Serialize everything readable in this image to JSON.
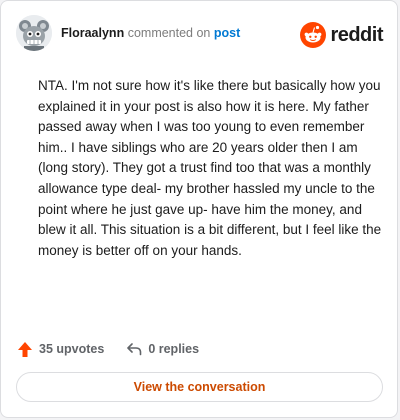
{
  "header": {
    "username": "Floraalynn",
    "action_text": "commented on",
    "post_link": "post",
    "brand": "reddit"
  },
  "comment": {
    "body": "NTA. I'm not sure how it's like there but basically how you explained it in your post is also how it is here. My father passed away when I was too young to even remember him.. I have siblings who are 20 years older then I am (long story). They got a trust find too that was a monthly allowance type deal- my brother hassled my uncle to the point where he just gave up- have him the money, and blew it all. This situation is a bit different, but I feel like the money is better off on your hands."
  },
  "actions": {
    "upvotes": "35 upvotes",
    "replies": "0 replies"
  },
  "footer": {
    "view_button": "View the conversation"
  },
  "colors": {
    "brand_orange": "#ff4500",
    "link_blue": "#0079d3",
    "button_text": "#cc4a00"
  },
  "icons": {
    "avatar": "snoo-avatar-icon",
    "logo": "reddit-logo-icon",
    "upvote": "upvote-arrow-icon",
    "reply": "reply-arrow-icon"
  }
}
